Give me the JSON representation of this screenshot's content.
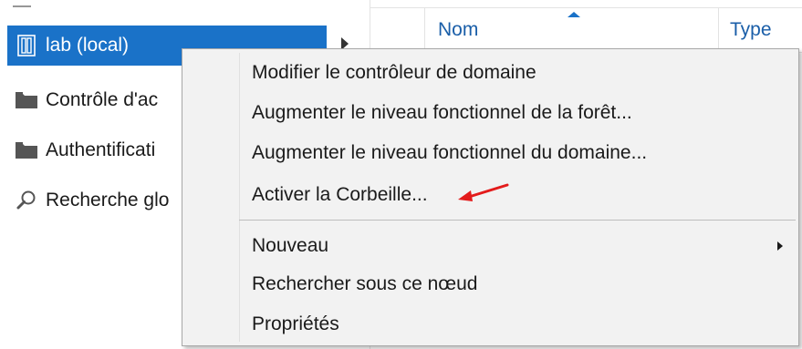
{
  "nav": {
    "items": [
      {
        "label": "lab (local)",
        "icon": "domain-controller-icon",
        "selected": true
      },
      {
        "label": "Contrôle d'ac",
        "icon": "folder-icon"
      },
      {
        "label": "Authentificati",
        "icon": "folder-icon"
      },
      {
        "label": "Recherche glo",
        "icon": "search-icon"
      }
    ]
  },
  "list": {
    "columns": [
      "Nom",
      "Type"
    ],
    "sort_column": "Nom",
    "sort_direction": "ascending"
  },
  "context_menu": {
    "items": [
      {
        "label": "Modifier le contrôleur de domaine"
      },
      {
        "label": "Augmenter le niveau fonctionnel de la forêt..."
      },
      {
        "label": "Augmenter le niveau fonctionnel du domaine..."
      },
      {
        "label": "Activer la Corbeille...",
        "annotated": true
      },
      {
        "label": "Nouveau",
        "has_submenu": true
      },
      {
        "label": "Rechercher sous ce nœud"
      },
      {
        "label": "Propriétés"
      }
    ]
  },
  "colors": {
    "selection": "#1a72c8",
    "header_text": "#1a5ea8",
    "menu_background": "#f2f2f2",
    "annotation_arrow": "#e31b1b"
  }
}
